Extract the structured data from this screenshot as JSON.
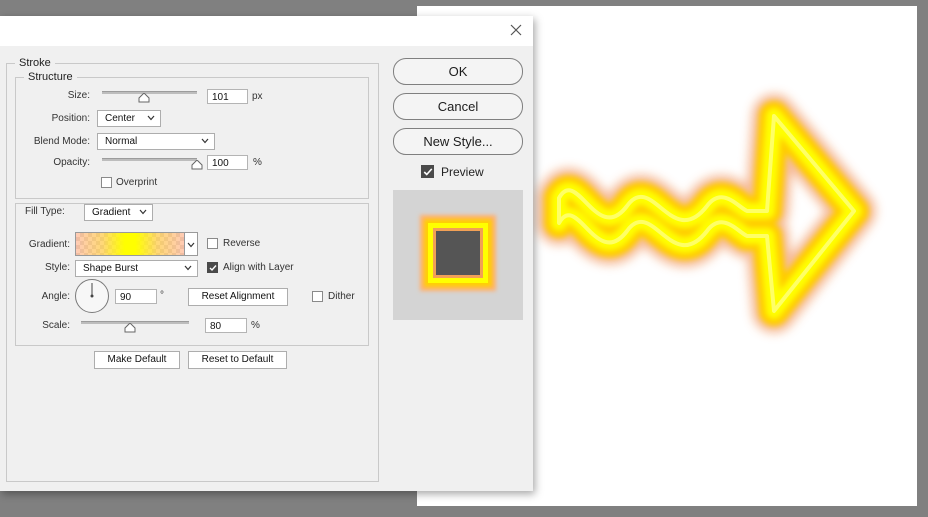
{
  "dialog": {
    "sections": {
      "stroke": "Stroke",
      "structure": "Structure"
    },
    "size": {
      "label": "Size:",
      "value": "101",
      "unit": "px",
      "slider_fraction": 0.4
    },
    "position": {
      "label": "Position:",
      "value": "Center"
    },
    "blend_mode": {
      "label": "Blend Mode:",
      "value": "Normal"
    },
    "opacity": {
      "label": "Opacity:",
      "value": "100",
      "unit": "%",
      "slider_fraction": 1.0
    },
    "overprint": {
      "label": "Overprint",
      "checked": false
    },
    "fill_type": {
      "label": "Fill Type:",
      "value": "Gradient"
    },
    "gradient": {
      "label": "Gradient:"
    },
    "reverse": {
      "label": "Reverse",
      "checked": false
    },
    "style": {
      "label": "Style:",
      "value": "Shape Burst"
    },
    "align_with_layer": {
      "label": "Align with Layer",
      "checked": true
    },
    "angle": {
      "label": "Angle:",
      "value": "90",
      "unit": "°"
    },
    "reset_alignment_label": "Reset Alignment",
    "dither": {
      "label": "Dither",
      "checked": false
    },
    "scale": {
      "label": "Scale:",
      "value": "80",
      "unit": "%",
      "slider_fraction": 0.45
    },
    "make_default_label": "Make Default",
    "reset_to_default_label": "Reset to Default",
    "ok_label": "OK",
    "cancel_label": "Cancel",
    "new_style_label": "New Style...",
    "preview": {
      "label": "Preview",
      "checked": true
    }
  },
  "colors": {
    "stroke_core": "#ffff00",
    "stroke_mid": "#ffcc00",
    "stroke_outer": "#f5b48c",
    "swatch_fill": "#555555",
    "canvas": "#ffffff",
    "workspace": "#808080"
  },
  "icons": {
    "close": "close-icon",
    "chevron": "chevron-down-icon",
    "check": "checkmark-icon"
  }
}
